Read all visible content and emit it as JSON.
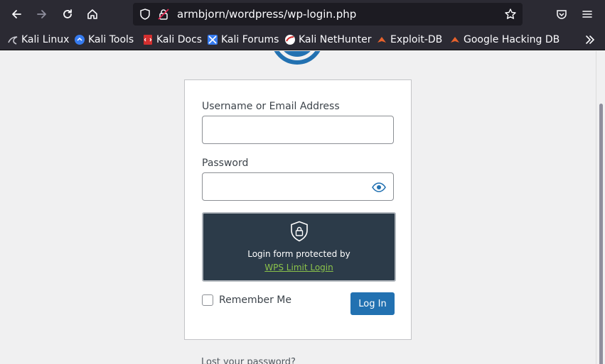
{
  "browser": {
    "url": "armbjorn/wordpress/wp-login.php",
    "bookmarks": [
      {
        "label": "Kali Linux",
        "icon": "kali-dragon-icon"
      },
      {
        "label": "Kali Tools",
        "icon": "kali-tools-icon"
      },
      {
        "label": "Kali Docs",
        "icon": "kali-docs-icon"
      },
      {
        "label": "Kali Forums",
        "icon": "kali-forums-icon"
      },
      {
        "label": "Kali NetHunter",
        "icon": "kali-nethunter-icon"
      },
      {
        "label": "Exploit-DB",
        "icon": "exploit-db-icon"
      },
      {
        "label": "Google Hacking DB",
        "icon": "ghdb-icon"
      }
    ]
  },
  "login": {
    "username_label": "Username or Email Address",
    "username_value": "",
    "password_label": "Password",
    "password_value": "",
    "wps_protected_text": "Login form protected by",
    "wps_link_text": "WPS Limit Login",
    "remember_label": "Remember Me",
    "login_button": "Log In",
    "lost_password": "Lost your password?"
  },
  "colors": {
    "browser_bg": "#2b2a33",
    "page_bg": "#f0f0f1",
    "primary_button": "#2271b1",
    "wps_box": "#2c3b49",
    "wps_link": "#8bc34a"
  }
}
